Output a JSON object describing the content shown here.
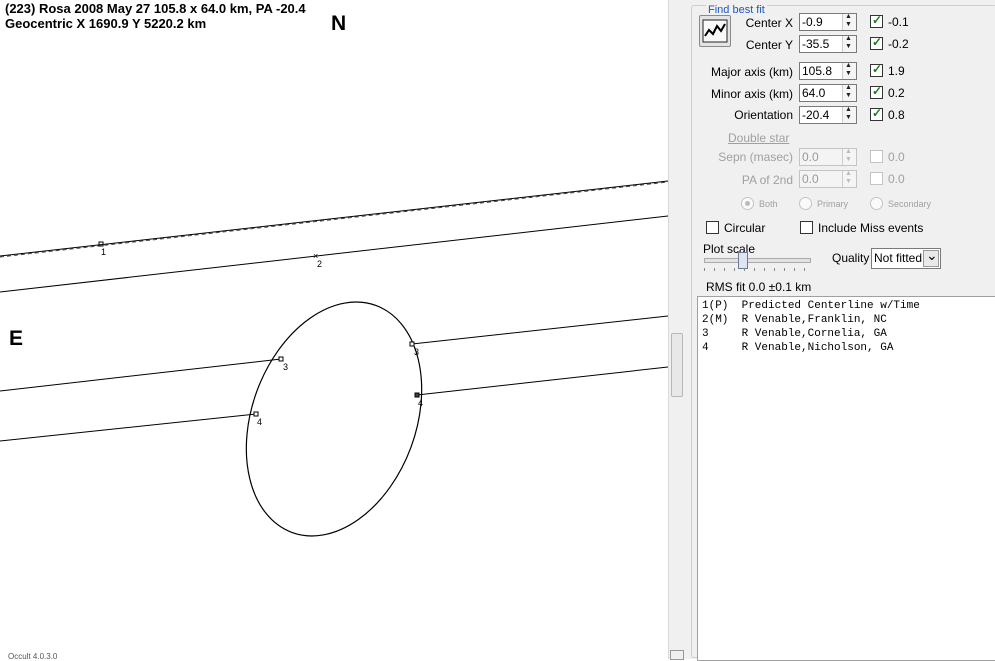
{
  "plot": {
    "header_line1": "(223) Rosa  2008 May 27  105.8 x 64.0 km, PA -20.4",
    "header_line2": "Geocentric  X  1690.9  Y 5220.2 km",
    "north_label": "N",
    "east_label": "E",
    "version_text": "Occult 4.0.3.0",
    "chords": [
      {
        "label": "1"
      },
      {
        "label": "2"
      },
      {
        "label": "3"
      },
      {
        "label": "3"
      },
      {
        "label": "4"
      },
      {
        "label": "4"
      }
    ]
  },
  "panel": {
    "group_title": "Find best fit",
    "find_fit_button_icon": "fit-chart-icon",
    "params": [
      {
        "label": "Center X",
        "value": "-0.9",
        "checked": true,
        "uncertainty": "-0.1"
      },
      {
        "label": "Center Y",
        "value": "-35.5",
        "checked": true,
        "uncertainty": "-0.2"
      },
      {
        "label": "Major axis (km)",
        "value": "105.8",
        "checked": true,
        "uncertainty": "1.9"
      },
      {
        "label": "Minor axis (km)",
        "value": "64.0",
        "checked": true,
        "uncertainty": "0.2"
      },
      {
        "label": "Orientation",
        "value": "-20.4",
        "checked": true,
        "uncertainty": "0.8"
      }
    ],
    "double_star": {
      "title": "Double star",
      "sepn_label": "Sepn (masec)",
      "sepn_value": "0.0",
      "sepn_unc": "0.0",
      "pa_label": "PA of 2nd",
      "pa_value": "0.0",
      "pa_unc": "0.0",
      "radios": [
        "Both",
        "Primary",
        "Secondary"
      ]
    },
    "circular_label": "Circular",
    "include_miss_label": "Include Miss events",
    "plot_scale_label": "Plot scale",
    "quality_label": "Quality",
    "quality_value": "Not fitted",
    "rms_text": "RMS fit 0.0 ±0.1 km",
    "observers": [
      "1(P)  Predicted Centerline w/Time",
      "2(M)  R Venable,Franklin, NC",
      "3     R Venable,Cornelia, GA",
      "4     R Venable,Nicholson, GA"
    ]
  },
  "colors": {
    "group_title": "#1b57c4",
    "check_mark": "#1c7b1c",
    "panel_bg": "#f0f0f0"
  }
}
